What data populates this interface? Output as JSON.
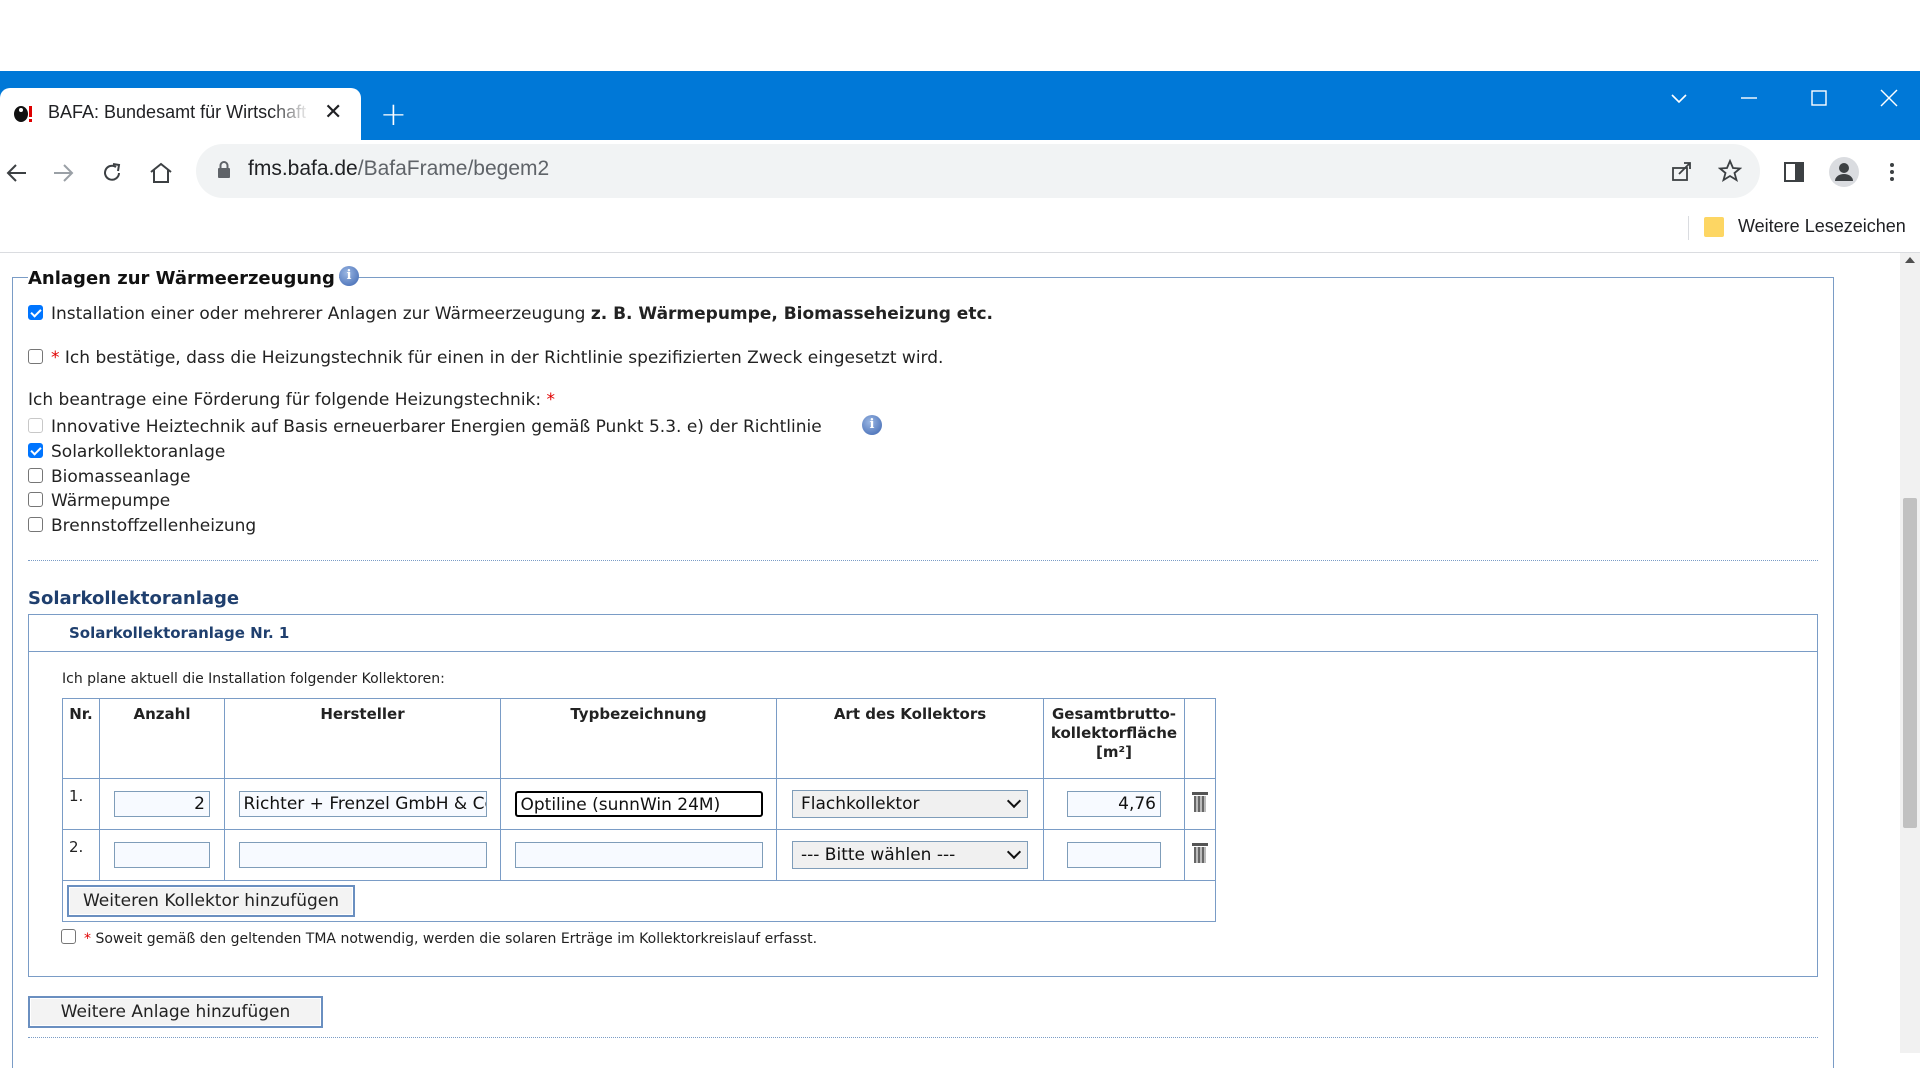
{
  "browser": {
    "tab_title": "BAFA: Bundesamt für Wirtschaft und Ausfuhrkontrolle",
    "tab_close": "✕",
    "new_tab": "+",
    "url_host": "fms.bafa.de",
    "url_path": "/BafaFrame/begem2",
    "bookmarks_label": "Weitere Lesezeichen"
  },
  "section": {
    "legend": "Anlagen zur Wärmeerzeugung",
    "install_text": "Installation einer oder mehrerer Anlagen zur Wärmeerzeugung",
    "install_bold": "z. B. Wärmepumpe, Biomasseheizung etc.",
    "confirm_text": "Ich bestätige, dass die Heizungstechnik für einen in der Richtlinie spezifizierten Zweck eingesetzt wird.",
    "request_label": "Ich beantrage eine Förderung für folgende Heizungstechnik:",
    "required_mark": "*",
    "options": [
      {
        "label": "Innovative Heiztechnik auf Basis erneuerbarer Energien gemäß Punkt 5.3. e) der Richtlinie",
        "checked": false
      },
      {
        "label": "Solarkollektoranlage",
        "checked": true
      },
      {
        "label": "Biomasseanlage",
        "checked": false
      },
      {
        "label": "Wärmepumpe",
        "checked": false
      },
      {
        "label": "Brennstoffzellenheizung",
        "checked": false
      }
    ]
  },
  "solar": {
    "title": "Solarkollektoranlage",
    "subtitle": "Solarkollektoranlage Nr. 1",
    "intro": "Ich plane aktuell die Installation folgender Kollektoren:",
    "headers": {
      "nr": "Nr.",
      "anzahl": "Anzahl",
      "hersteller": "Hersteller",
      "typ": "Typbezeichnung",
      "art": "Art des Kollektors",
      "flaeche_1": "Gesamtbrutto-",
      "flaeche_2": "kollektorfläche",
      "flaeche_unit": "[m²]"
    },
    "rows": [
      {
        "nr": "1.",
        "anzahl": "2",
        "hersteller": "Richter + Frenzel GmbH & Co. KG",
        "typ": "Optiline (sunnWin 24M)",
        "art": "Flachkollektor",
        "flaeche": "4,76"
      },
      {
        "nr": "2.",
        "anzahl": "",
        "hersteller": "",
        "typ": "",
        "art": "--- Bitte wählen ---",
        "flaeche": ""
      }
    ],
    "add_collector": "Weiteren Kollektor hinzufügen",
    "tma_text": "Soweit gemäß den geltenden TMA notwendig, werden die solaren Erträge im Kollektorkreislauf erfasst.",
    "add_plant": "Weitere Anlage hinzufügen"
  }
}
